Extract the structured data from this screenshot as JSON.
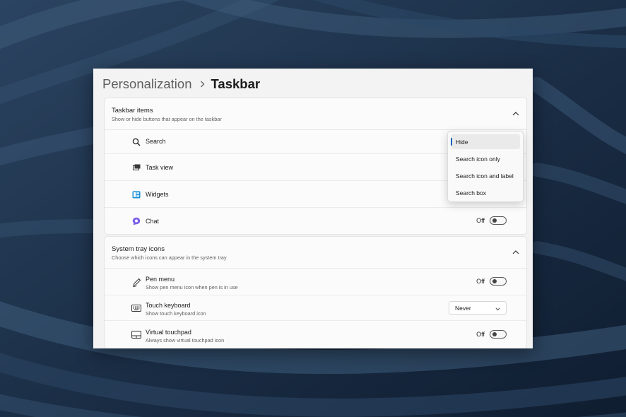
{
  "breadcrumb": {
    "parent": "Personalization",
    "current": "Taskbar"
  },
  "taskbar_items": {
    "title": "Taskbar items",
    "subtitle": "Show or hide buttons that appear on the taskbar",
    "rows": [
      {
        "label": "Search",
        "icon": "search-icon"
      },
      {
        "label": "Task view",
        "icon": "task-view-icon"
      },
      {
        "label": "Widgets",
        "icon": "widgets-icon"
      },
      {
        "label": "Chat",
        "icon": "chat-icon",
        "toggle_state": "Off"
      }
    ]
  },
  "search_dropdown": {
    "selected": "Hide",
    "options": [
      "Hide",
      "Search icon only",
      "Search icon and label",
      "Search box"
    ]
  },
  "system_tray": {
    "title": "System tray icons",
    "subtitle": "Choose which icons can appear in the system tray",
    "rows": [
      {
        "label": "Pen menu",
        "sub": "Show pen menu icon when pen is in use",
        "icon": "pen-icon",
        "toggle_state": "Off"
      },
      {
        "label": "Touch keyboard",
        "sub": "Show touch keyboard icon",
        "icon": "keyboard-icon",
        "select_value": "Never"
      },
      {
        "label": "Virtual touchpad",
        "sub": "Always show virtual touchpad icon",
        "icon": "touchpad-icon",
        "toggle_state": "Off"
      }
    ]
  },
  "colors": {
    "accent": "#005fb8",
    "chat_purple": "#7b61e8",
    "widgets_blue": "#1a8fd6"
  }
}
